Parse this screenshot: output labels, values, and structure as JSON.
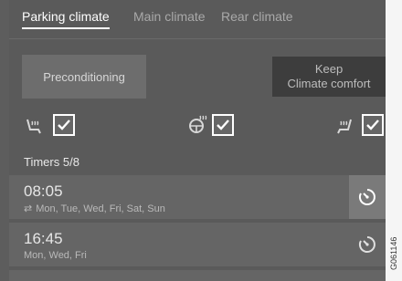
{
  "tabs": [
    {
      "label": "Parking climate",
      "active": true
    },
    {
      "label": "Main climate",
      "active": false
    },
    {
      "label": "Rear climate",
      "active": false
    }
  ],
  "buttons": {
    "preconditioning": "Preconditioning",
    "keep_line1": "Keep",
    "keep_line2": "Climate comfort"
  },
  "options": [
    {
      "icon": "heated-seat-icon",
      "checked": true
    },
    {
      "icon": "steering-wheel-heat-icon",
      "checked": true
    },
    {
      "icon": "heated-seat-icon",
      "checked": true
    }
  ],
  "timers": {
    "header": "Timers 5/8",
    "items": [
      {
        "time": "08:05",
        "days": "Mon, Tue, Wed, Fri, Sat, Sun",
        "repeat": true
      },
      {
        "time": "16:45",
        "days": "Mon, Wed, Fri",
        "repeat": false
      }
    ]
  },
  "side_code": "G061146",
  "colors": {
    "background": "#5a5a5a",
    "button": "#6d6d6d",
    "keep_button": "#3d3d3d"
  }
}
